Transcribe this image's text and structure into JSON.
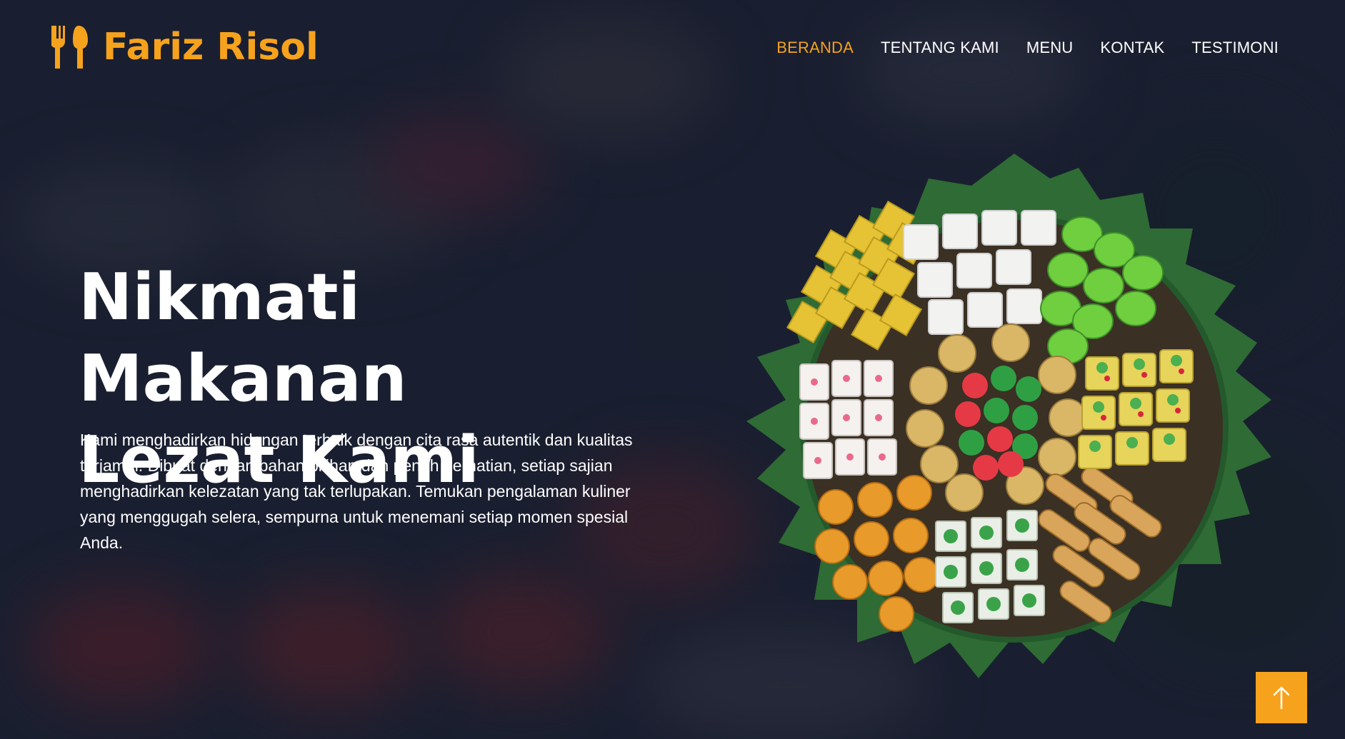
{
  "brand": {
    "name": "Fariz Risol",
    "icon": "utensils-icon",
    "color": "#f6a21d"
  },
  "nav": {
    "items": [
      {
        "label": "BERANDA",
        "active": true
      },
      {
        "label": "TENTANG KAMI",
        "active": false
      },
      {
        "label": "MENU",
        "active": false
      },
      {
        "label": "KONTAK",
        "active": false
      },
      {
        "label": "TESTIMONI",
        "active": false
      }
    ]
  },
  "hero": {
    "title_line1": "Nikmati Makanan",
    "title_line2": "Lezat Kami",
    "description": "Kami menghadirkan hidangan terbaik dengan cita rasa autentik dan kualitas terjamin. Dibuat dengan bahan pilihan dan penuh perhatian, setiap sajian menghadirkan kelezatan yang tak terlupakan. Temukan pengalaman kuliner yang menggugah selera, sempurna untuk menemani setiap momen spesial Anda."
  },
  "scroll_top": {
    "icon": "arrow-up-icon"
  },
  "colors": {
    "accent": "#f6a21d",
    "background": "#232a3c",
    "text": "#ffffff"
  }
}
